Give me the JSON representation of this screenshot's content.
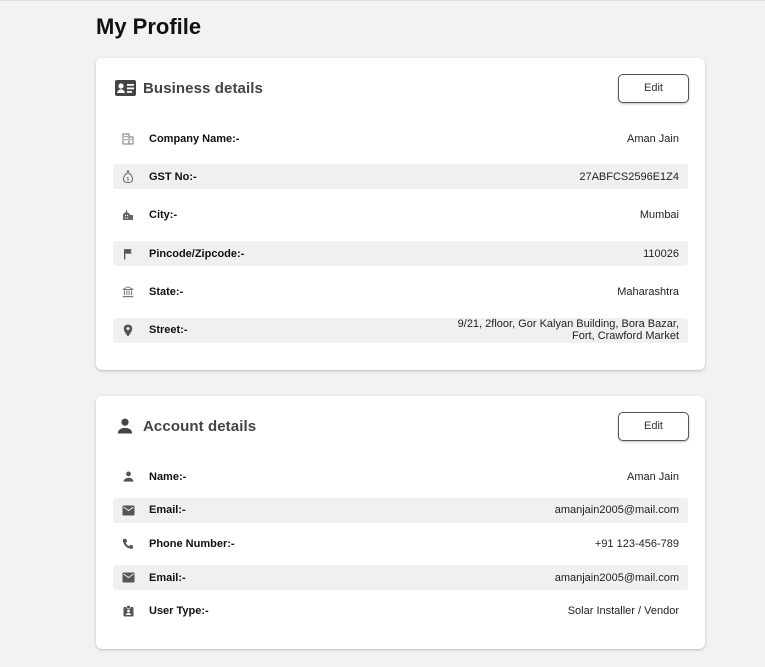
{
  "page": {
    "title": "My Profile"
  },
  "business": {
    "title": "Business details",
    "icon": "id-card-icon",
    "edit_label": "Edit",
    "rows": [
      {
        "icon": "building-icon",
        "label": "Company Name:-",
        "value": "Aman Jain"
      },
      {
        "icon": "money-bag-icon",
        "label": "GST No:-",
        "value": "27ABFCS2596E1Z4"
      },
      {
        "icon": "city-icon",
        "label": "City:-",
        "value": "Mumbai"
      },
      {
        "icon": "flag-icon",
        "label": "Pincode/Zipcode:-",
        "value": "110026"
      },
      {
        "icon": "bank-icon",
        "label": "State:-",
        "value": "Maharashtra"
      },
      {
        "icon": "location-pin-icon",
        "label": "Street:-",
        "value_line1": "9/21, 2floor, Gor Kalyan Building, Bora Bazar,",
        "value_line2": "Fort, Crawford Market"
      }
    ]
  },
  "account": {
    "title": "Account details",
    "icon": "person-icon",
    "edit_label": "Edit",
    "rows": [
      {
        "icon": "person-icon",
        "label": "Name:-",
        "value": "Aman Jain"
      },
      {
        "icon": "email-icon",
        "label": "Email:-",
        "value": "amanjain2005@mail.com"
      },
      {
        "icon": "phone-icon",
        "label": "Phone Number:-",
        "value": "+91 123-456-789"
      },
      {
        "icon": "email-icon",
        "label": "Email:-",
        "value": "amanjain2005@mail.com"
      },
      {
        "icon": "badge-icon",
        "label": "User Type:-",
        "value": "Solar Installer / Vendor"
      }
    ]
  }
}
